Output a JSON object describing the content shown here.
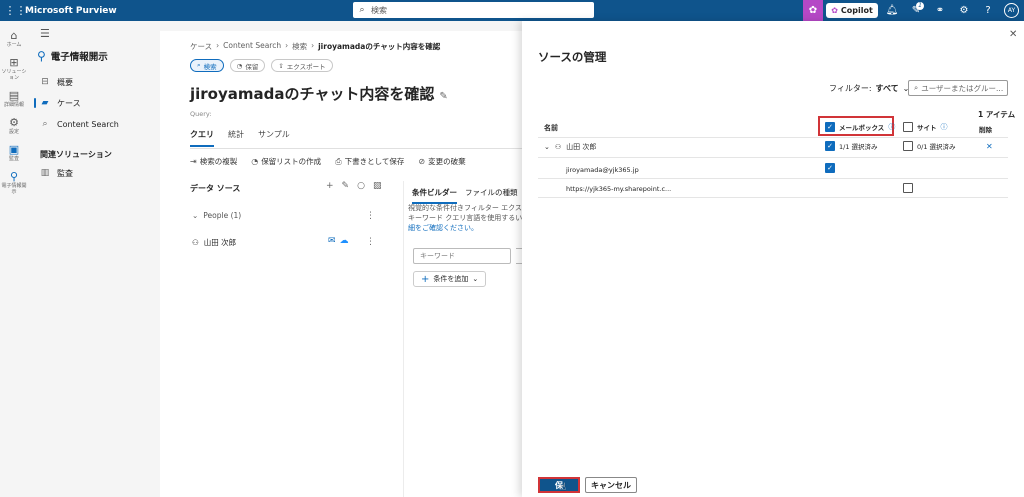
{
  "topbar": {
    "waffle_icon": "waffle-icon",
    "app_title": "Microsoft Purview",
    "search_placeholder": "検索",
    "copilot_label": "Copilot",
    "notification_count": "1",
    "avatar_initials": "AY"
  },
  "rail": {
    "items": [
      {
        "label": "ホーム",
        "icon": "home-icon"
      },
      {
        "label": "ソリューション",
        "icon": "apps-icon"
      },
      {
        "label": "詳細情報",
        "icon": "book-icon"
      },
      {
        "label": "設定",
        "icon": "gear-icon"
      },
      {
        "label": "監査",
        "icon": "audit-icon"
      },
      {
        "label": "電子情報開示",
        "icon": "ediscovery-icon"
      }
    ]
  },
  "nav": {
    "header": "電子情報開示",
    "items": [
      {
        "label": "概要"
      },
      {
        "label": "ケース"
      },
      {
        "label": "Content Search"
      }
    ],
    "section": "関連ソリューション",
    "related": [
      {
        "label": "監査"
      }
    ]
  },
  "main": {
    "breadcrumb": [
      "ケース",
      "Content Search",
      "検索",
      "jiroyamadaのチャット内容を確認"
    ],
    "chips": [
      "検索",
      "保留",
      "エクスポート"
    ],
    "title": "jiroyamadaのチャット内容を確認",
    "query_label": "Query:",
    "tabs": [
      "クエリ",
      "統計",
      "サンプル"
    ],
    "toolbar": [
      "検索の複製",
      "保留リストの作成",
      "下書きとして保存",
      "変更の破棄"
    ],
    "data_source": {
      "title": "データ ソース",
      "group": "People (1)",
      "person": "山田 次郎"
    },
    "query_builder": {
      "tabs": [
        "条件ビルダー",
        "ファイルの種類"
      ],
      "desc_line1": "視覚的な条件付きフィルター エクス",
      "desc_line2": "キーワード クエリ言語を使用するい",
      "desc_line3": "細をご確認ください。",
      "keyword_placeholder": "キーワード",
      "add_condition": "条件を追加"
    }
  },
  "flyout": {
    "title": "ソースの管理",
    "filter_label": "フィルター:",
    "filter_value": "すべて",
    "search_placeholder": "ユーザーまたはグルー...",
    "count": "1 アイテム",
    "columns": {
      "name": "名前",
      "mailbox": "メールボックス",
      "site": "サイト",
      "delete": "削除"
    },
    "rows": {
      "person": "山田 次郎",
      "mailbox_state": "1/1 選択済み",
      "site_state": "0/1 選択済み",
      "email": "jiroyamada@yjk365.jp",
      "site_url": "https://yjk365-my.sharepoint.c..."
    },
    "save": "保",
    "cancel": "キャンセル"
  }
}
